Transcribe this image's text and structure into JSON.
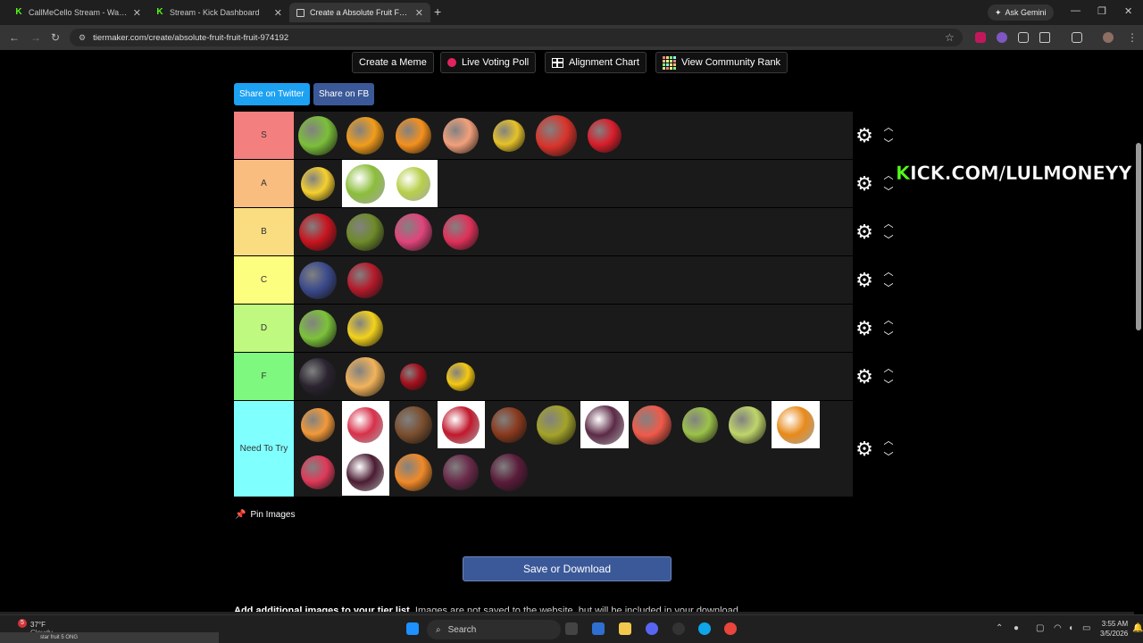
{
  "browser": {
    "tabs": [
      {
        "title": "CallMeCello Stream - Watch Li...",
        "favicon": "kick"
      },
      {
        "title": "Stream - Kick Dashboard",
        "favicon": "kick"
      },
      {
        "title": "Create a Absolute Fruit Fruit Fr...",
        "favicon": "tiermaker",
        "active": true
      }
    ],
    "new_tab": "+",
    "ask_gemini": "Ask Gemini",
    "url": "tiermaker.com/create/absolute-fruit-fruit-fruit-974192"
  },
  "toolbar": {
    "create_meme": "Create a Meme",
    "live_voting_poll": "Live Voting Poll",
    "alignment_chart": "Alignment Chart",
    "view_community_rank": "View Community Rank"
  },
  "share": {
    "twitter": "Share on Twitter",
    "fb": "Share on FB"
  },
  "tiers": [
    {
      "label": "S",
      "color": "#f47f7f",
      "items": [
        "grapes",
        "mango",
        "orange",
        "peach",
        "pineapple",
        "watermelon",
        "strawberry"
      ]
    },
    {
      "label": "A",
      "color": "#f8bd7f",
      "items": [
        "banana",
        "kiwi",
        "pear"
      ]
    },
    {
      "label": "B",
      "color": "#f9dd80",
      "items": [
        "apple",
        "avocado",
        "dragon fruit",
        "raspberry"
      ]
    },
    {
      "label": "C",
      "color": "#fcfe7f",
      "items": [
        "blueberries",
        "pomegranate"
      ]
    },
    {
      "label": "D",
      "color": "#bff97f",
      "items": [
        "lime",
        "star fruit"
      ]
    },
    {
      "label": "F",
      "color": "#7ff87f",
      "items": [
        "blackberries",
        "cantaloupe",
        "cherries",
        "lemon"
      ]
    },
    {
      "label": "Need To Try",
      "color": "#80ffff",
      "items": [
        "apricot",
        "rambutan",
        "coconut",
        "cranberries",
        "dates",
        "durian",
        "fig",
        "grapefruit",
        "guava",
        "honeydew",
        "kiwano",
        "lychee",
        "mangosteen",
        "papaya",
        "passion fruit",
        "plum"
      ]
    }
  ],
  "overlay": {
    "prefix": "K",
    "text": "ICK.COM/LULMONEYY"
  },
  "pin_images": "Pin Images",
  "save_button": "Save or Download",
  "add_note": {
    "bold": "Add additional images to your tier list.",
    "rest": " Images are not saved to the website, but will be included in your download."
  },
  "taskbar": {
    "weather_temp": "37°F",
    "weather_desc": "Cloudy",
    "notif_count": "5",
    "drag_caption": "star fruit 5 ONG",
    "search": "Search",
    "time": "3:55 AM",
    "date": "3/5/2026"
  },
  "icons": {
    "tier_settings": "gear-icon",
    "move_up": "chevron-up-icon",
    "move_down": "chevron-down-icon",
    "pin": "pin-icon"
  }
}
